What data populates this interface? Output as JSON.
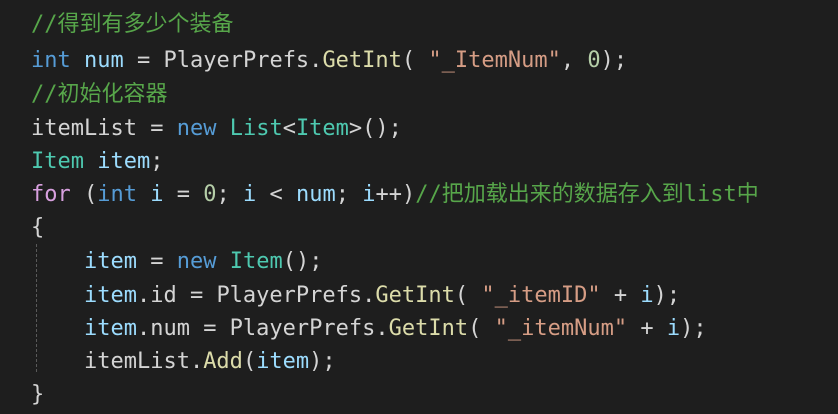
{
  "editor": {
    "colors": {
      "background": "#1e1e1e",
      "comment": "#57a64a",
      "keyword": "#569cd6",
      "control": "#d8a0df",
      "type": "#4ec9b0",
      "variable": "#9cdcfe",
      "method": "#dcdcaa",
      "string": "#d69d85",
      "number": "#b5cea8",
      "plain": "#d4d4d4"
    },
    "lines": [
      [
        {
          "c": "comment",
          "t": "//得到有多少个装备"
        }
      ],
      [
        {
          "c": "keyword",
          "t": "int"
        },
        {
          "c": "plain",
          "t": " "
        },
        {
          "c": "var",
          "t": "num"
        },
        {
          "c": "plain",
          "t": " = PlayerPrefs."
        },
        {
          "c": "method",
          "t": "GetInt"
        },
        {
          "c": "plain",
          "t": "( "
        },
        {
          "c": "string",
          "t": "\"_ItemNum\""
        },
        {
          "c": "plain",
          "t": ", "
        },
        {
          "c": "number",
          "t": "0"
        },
        {
          "c": "plain",
          "t": ");"
        }
      ],
      [
        {
          "c": "comment",
          "t": "//初始化容器"
        }
      ],
      [
        {
          "c": "plain",
          "t": "itemList = "
        },
        {
          "c": "keyword",
          "t": "new"
        },
        {
          "c": "plain",
          "t": " "
        },
        {
          "c": "type",
          "t": "List"
        },
        {
          "c": "plain",
          "t": "<"
        },
        {
          "c": "type",
          "t": "Item"
        },
        {
          "c": "plain",
          "t": ">();"
        }
      ],
      [
        {
          "c": "type",
          "t": "Item"
        },
        {
          "c": "plain",
          "t": " "
        },
        {
          "c": "var",
          "t": "item"
        },
        {
          "c": "plain",
          "t": ";"
        }
      ],
      [
        {
          "c": "control",
          "t": "for"
        },
        {
          "c": "plain",
          "t": " ("
        },
        {
          "c": "keyword",
          "t": "int"
        },
        {
          "c": "plain",
          "t": " "
        },
        {
          "c": "var",
          "t": "i"
        },
        {
          "c": "plain",
          "t": " = "
        },
        {
          "c": "number",
          "t": "0"
        },
        {
          "c": "plain",
          "t": "; "
        },
        {
          "c": "var",
          "t": "i"
        },
        {
          "c": "plain",
          "t": " < "
        },
        {
          "c": "var",
          "t": "num"
        },
        {
          "c": "plain",
          "t": "; "
        },
        {
          "c": "var",
          "t": "i"
        },
        {
          "c": "plain",
          "t": "++)"
        },
        {
          "c": "comment",
          "t": "//把加载出来的数据存入到list中"
        }
      ],
      [
        {
          "c": "plain",
          "t": "{"
        }
      ],
      [
        {
          "c": "plain",
          "t": "    "
        },
        {
          "c": "var",
          "t": "item"
        },
        {
          "c": "plain",
          "t": " = "
        },
        {
          "c": "keyword",
          "t": "new"
        },
        {
          "c": "plain",
          "t": " "
        },
        {
          "c": "type",
          "t": "Item"
        },
        {
          "c": "plain",
          "t": "();"
        }
      ],
      [
        {
          "c": "plain",
          "t": "    "
        },
        {
          "c": "var",
          "t": "item"
        },
        {
          "c": "plain",
          "t": ".id = PlayerPrefs."
        },
        {
          "c": "method",
          "t": "GetInt"
        },
        {
          "c": "plain",
          "t": "( "
        },
        {
          "c": "string",
          "t": "\"_itemID\""
        },
        {
          "c": "plain",
          "t": " + "
        },
        {
          "c": "var",
          "t": "i"
        },
        {
          "c": "plain",
          "t": ");"
        }
      ],
      [
        {
          "c": "plain",
          "t": "    "
        },
        {
          "c": "var",
          "t": "item"
        },
        {
          "c": "plain",
          "t": ".num = PlayerPrefs."
        },
        {
          "c": "method",
          "t": "GetInt"
        },
        {
          "c": "plain",
          "t": "( "
        },
        {
          "c": "string",
          "t": "\"_itemNum\""
        },
        {
          "c": "plain",
          "t": " + "
        },
        {
          "c": "var",
          "t": "i"
        },
        {
          "c": "plain",
          "t": ");"
        }
      ],
      [
        {
          "c": "plain",
          "t": "    itemList."
        },
        {
          "c": "method",
          "t": "Add"
        },
        {
          "c": "plain",
          "t": "("
        },
        {
          "c": "var",
          "t": "item"
        },
        {
          "c": "plain",
          "t": ");"
        }
      ],
      [
        {
          "c": "plain",
          "t": "}"
        }
      ]
    ]
  }
}
